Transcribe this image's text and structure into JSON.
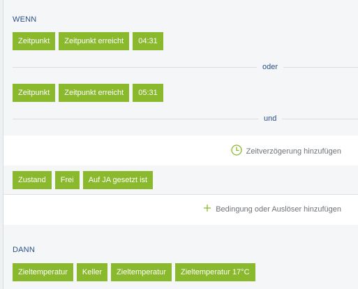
{
  "wenn": {
    "heading": "WENN",
    "trigger1": {
      "type_label": "Zeitpunkt",
      "condition_label": "Zeitpunkt erreicht",
      "time": "04:31"
    },
    "connector_or": "oder",
    "trigger2": {
      "type_label": "Zeitpunkt",
      "condition_label": "Zeitpunkt erreicht",
      "time": "05:31"
    },
    "connector_and": "und"
  },
  "delay": {
    "label": "Zeitverzögerung hinzufügen",
    "icon": "clock-icon"
  },
  "state_condition": {
    "type_label": "Zustand",
    "subject": "Frei",
    "condition": "Auf JA gesetzt ist"
  },
  "add_condition": {
    "label": "Bedingung oder Auslöser hinzufügen",
    "icon": "plus-icon"
  },
  "dann": {
    "heading": "DANN",
    "action": {
      "type_label": "Zieltemperatur",
      "room": "Keller",
      "property": "Zieltemperatur",
      "value": "Zieltemperatur 17°C"
    }
  },
  "colors": {
    "chip_bg": "#8ab92d",
    "heading_text": "#2a4f88",
    "muted_text": "#6e7378",
    "panel_bg": "#f5f6f7"
  }
}
